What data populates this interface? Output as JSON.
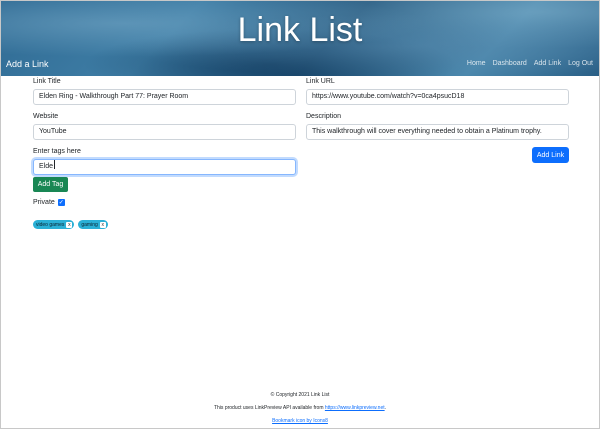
{
  "header": {
    "title": "Link List",
    "subtitle": "Add a Link",
    "nav": [
      "Home",
      "Dashboard",
      "Add Link",
      "Log Out"
    ]
  },
  "form": {
    "link_title_label": "Link Title",
    "link_title_value": "Elden Ring - Walkthrough Part 77: Prayer Room",
    "link_url_label": "Link URL",
    "link_url_value": "https://www.youtube.com/watch?v=0ca4psucD18",
    "website_label": "Website",
    "website_value": "YouTube",
    "description_label": "Description",
    "description_value": "This walkthrough will cover everything needed to obtain a Platinum trophy.",
    "tags_label": "Enter tags here",
    "tags_value": "Elde",
    "add_tag_label": "Add Tag",
    "add_link_label": "Add Link",
    "private_label": "Private",
    "private_checked": true,
    "tags": [
      {
        "label": "video games",
        "remove": "x"
      },
      {
        "label": "gaming",
        "remove": "x"
      }
    ]
  },
  "footer": {
    "copyright": "© Copyright 2021 Link List",
    "api_text": "This product uses LinkPreview API available from",
    "api_link": "https://www.linkpreview.net",
    "api_suffix": ".",
    "icon_credit": "Bookmark icon by Icons8"
  },
  "colors": {
    "primary": "#0d6efd",
    "success": "#198754",
    "tag": "#2ab0d6"
  },
  "icons": [
    "checkbox-checked-icon",
    "tag-remove-icon"
  ]
}
